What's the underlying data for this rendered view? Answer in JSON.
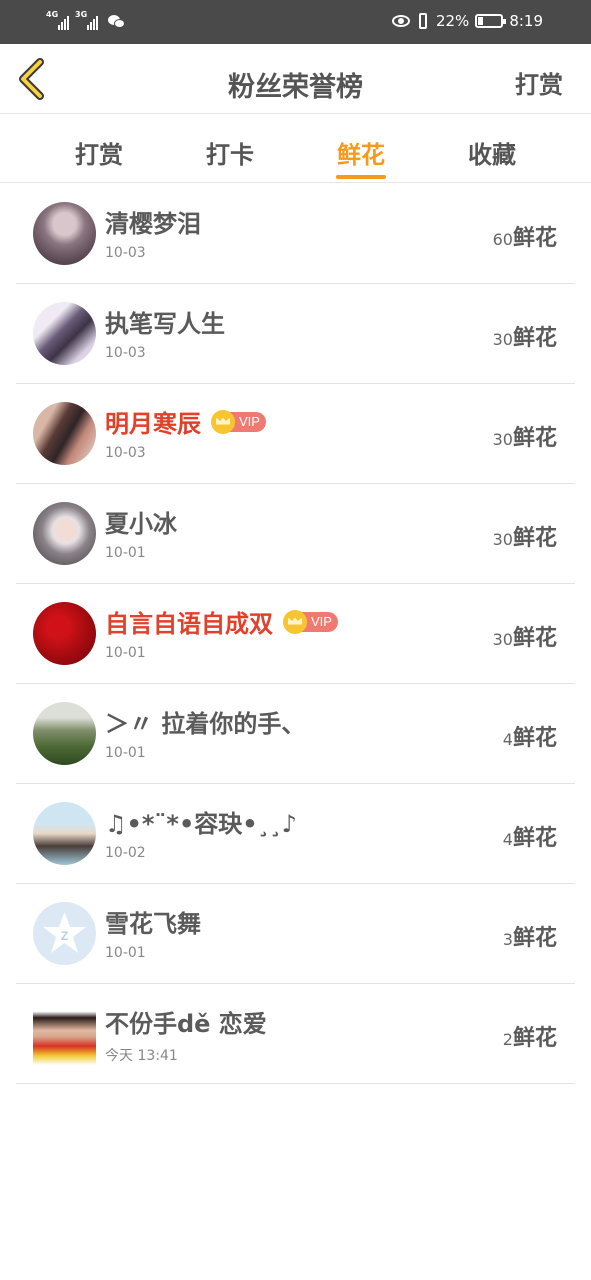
{
  "status_bar": {
    "network1": "4G",
    "network2": "3G",
    "battery_percent": "22%",
    "battery_level": 0.22,
    "time": "8:19"
  },
  "header": {
    "back_icon": "chevron-left-icon",
    "title": "粉丝荣誉榜",
    "action": "打赏"
  },
  "tabs": [
    {
      "label": "打赏",
      "active": false
    },
    {
      "label": "打卡",
      "active": false
    },
    {
      "label": "鲜花",
      "active": true
    },
    {
      "label": "收藏",
      "active": false
    }
  ],
  "colors": {
    "accent": "#f59a1d",
    "vip_name": "#e3402a",
    "vip_badge": "#f07a72"
  },
  "vip_label": "VIP",
  "unit": "鲜花",
  "rows": [
    {
      "name": "清樱梦泪",
      "date": "10-03",
      "count": "60",
      "vip": false
    },
    {
      "name": "执笔写人生",
      "date": "10-03",
      "count": "30",
      "vip": false
    },
    {
      "name": "明月寒辰",
      "date": "10-03",
      "count": "30",
      "vip": true
    },
    {
      "name": "夏小冰",
      "date": "10-01",
      "count": "30",
      "vip": false
    },
    {
      "name": "自言自语自成双",
      "date": "10-01",
      "count": "30",
      "vip": true
    },
    {
      "name": "＞〃 拉着你的手、",
      "date": "10-01",
      "count": "4",
      "vip": false
    },
    {
      "name": "♫•*¨*•容玦•¸¸♪",
      "date": "10-02",
      "count": "4",
      "vip": false
    },
    {
      "name": "雪花飞舞",
      "date": "10-01",
      "count": "3",
      "vip": false
    },
    {
      "name": "不份手dě 恋爱",
      "date": "今天 13:41",
      "count": "2",
      "vip": false
    }
  ]
}
